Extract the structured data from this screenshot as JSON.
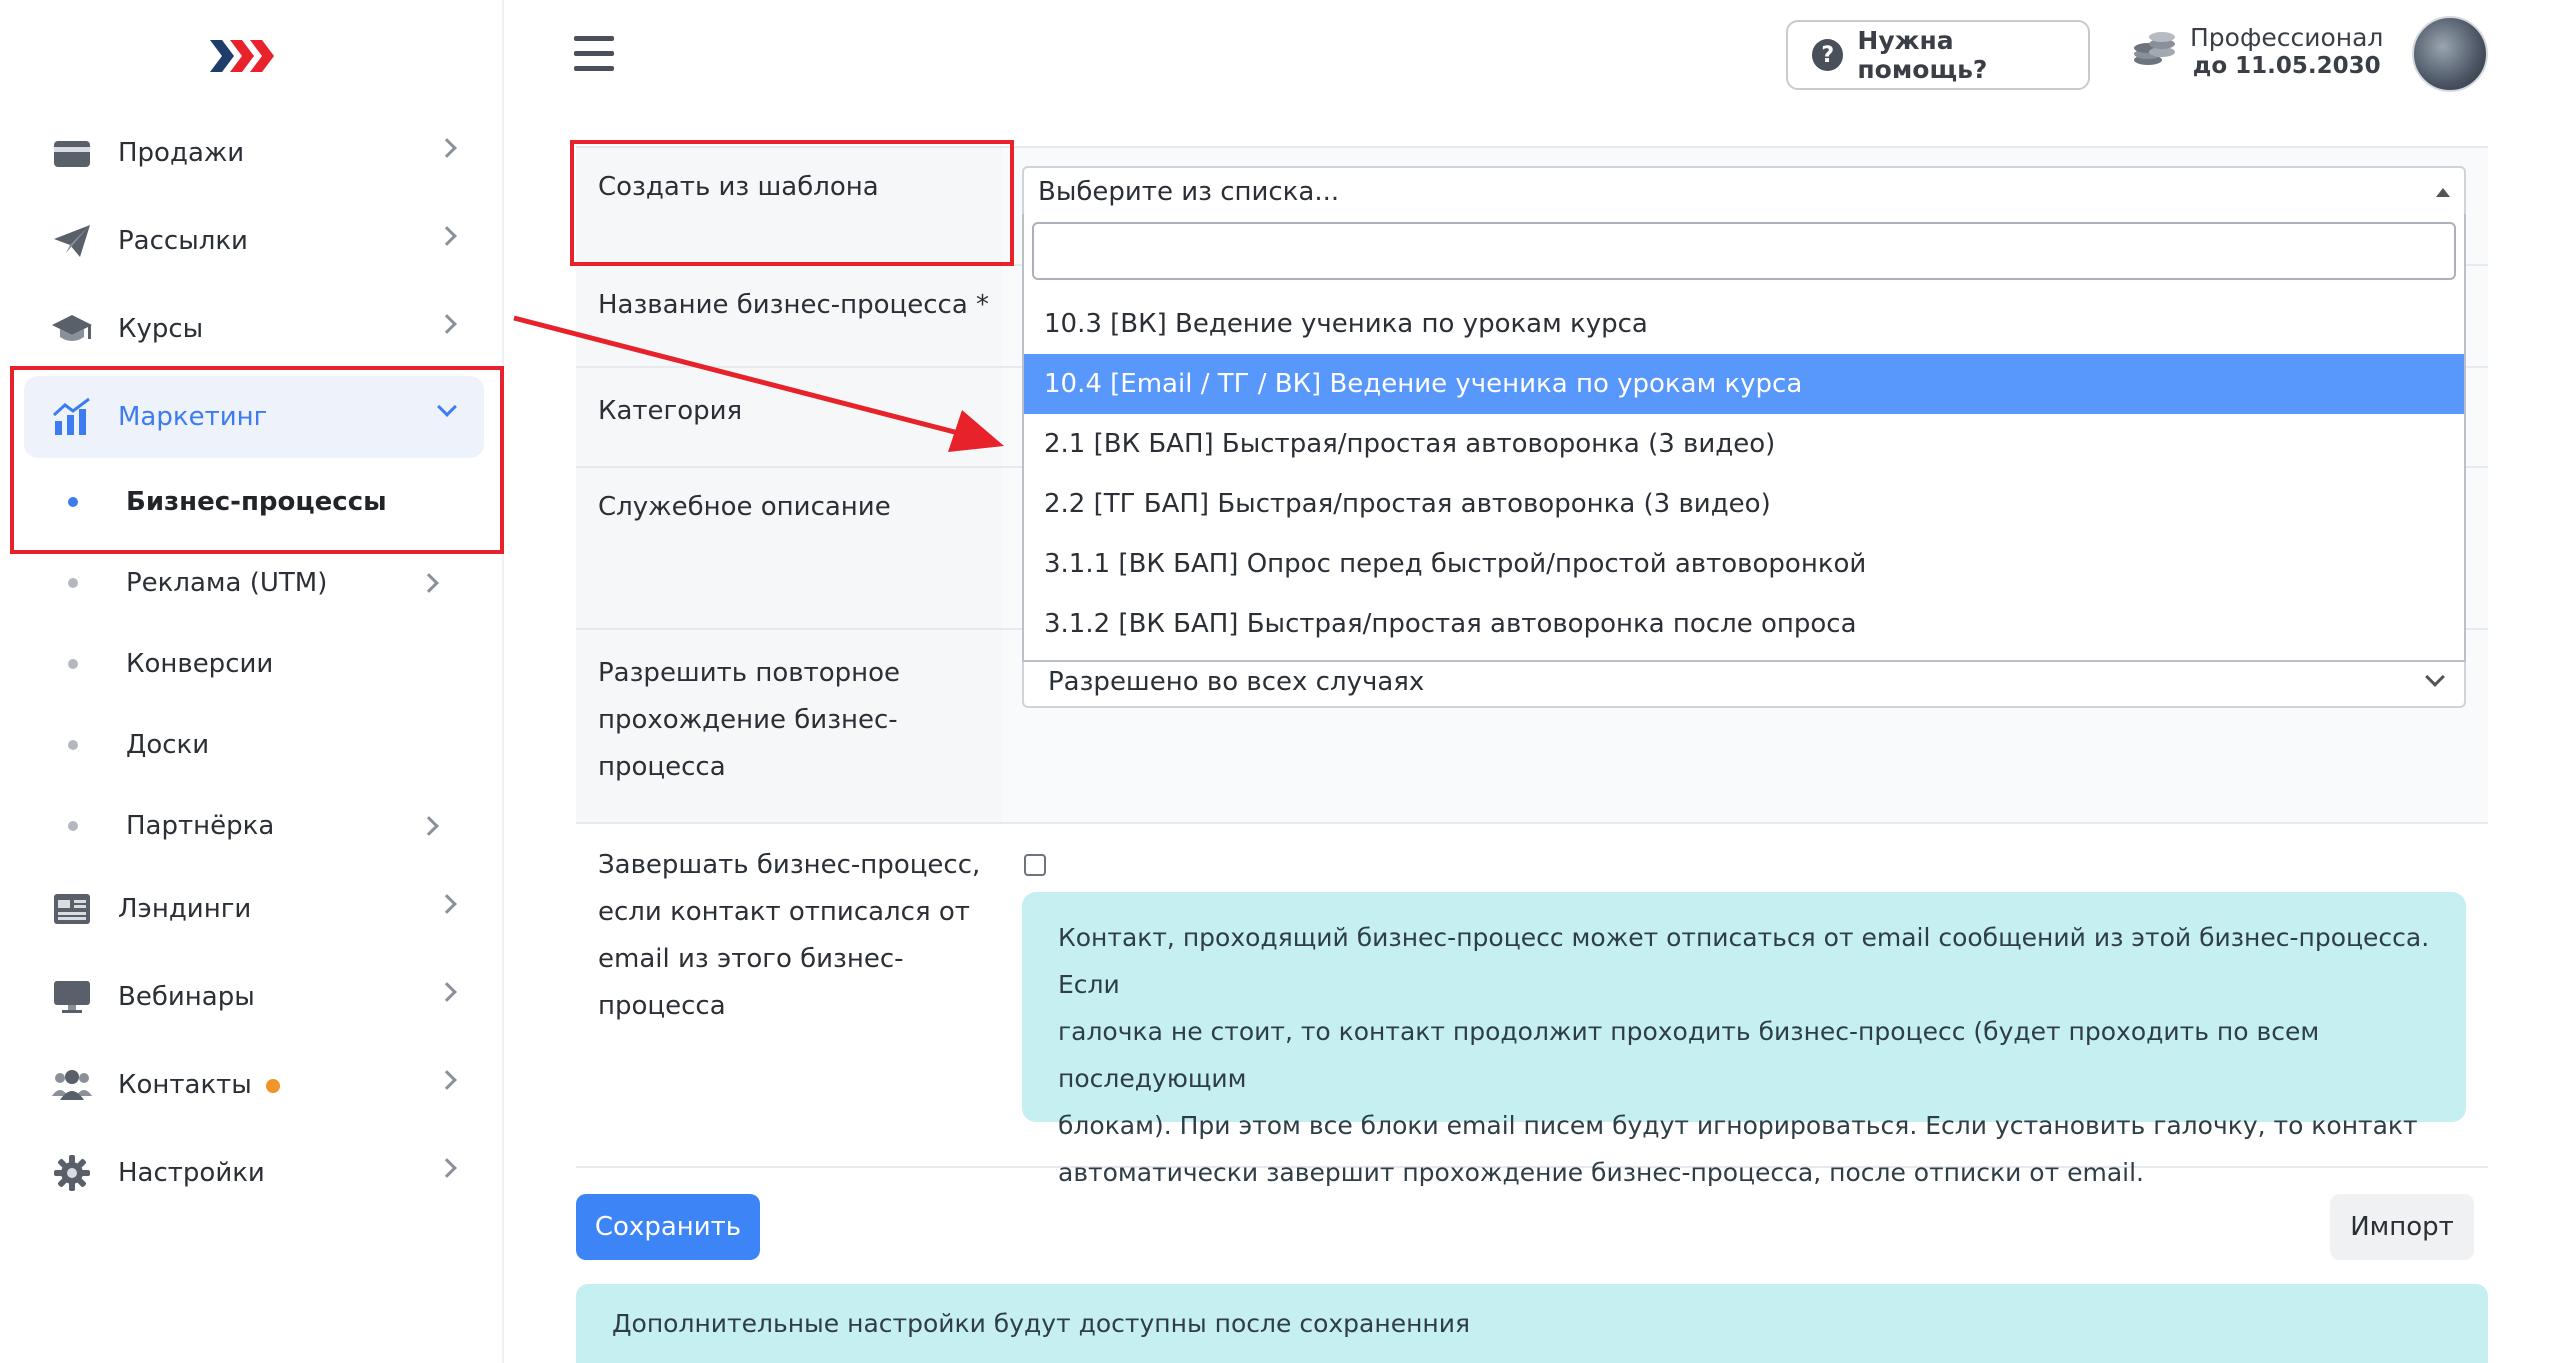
{
  "brand": {
    "logo_icon": "chevrons-logo-icon",
    "accent": "#3d7cf0",
    "highlight_color": "#e8222a"
  },
  "sidebar": {
    "items": [
      {
        "label": "Продажи",
        "icon": "credit-card-icon"
      },
      {
        "label": "Рассылки",
        "icon": "paper-plane-icon"
      },
      {
        "label": "Курсы",
        "icon": "graduation-cap-icon"
      },
      {
        "label": "Маркетинг",
        "icon": "chart-up-icon",
        "active": true
      },
      {
        "label": "Лэндинги",
        "icon": "landing-page-icon"
      },
      {
        "label": "Вебинары",
        "icon": "monitor-icon"
      },
      {
        "label": "Контакты",
        "icon": "users-icon"
      },
      {
        "label": "Настройки",
        "icon": "gear-icon"
      }
    ],
    "sub_items": [
      {
        "label": "Бизнес-процессы",
        "active": true
      },
      {
        "label": "Реклама (UTM)"
      },
      {
        "label": "Конверсии"
      },
      {
        "label": "Доски"
      },
      {
        "label": "Партнёрка"
      }
    ]
  },
  "header": {
    "help_label": "Нужна помощь?",
    "plan_name": "Профессионал",
    "plan_date": "до 11.05.2030"
  },
  "form": {
    "template_label": "Создать из шаблона",
    "template_placeholder": "Выберите из списка...",
    "name_label": "Название бизнес-процесса *",
    "category_label": "Категория",
    "description_label": "Служебное описание",
    "repeat_label_lines": [
      "Разрешить повторное",
      "прохождение бизнес-",
      "процесса"
    ],
    "repeat_value": "Разрешено во всех случаях",
    "finish_label_lines": [
      "Завершать бизнес-процесс,",
      "если контакт отписался от",
      "email из этого бизнес-",
      "процесса"
    ],
    "finish_checked": false,
    "finish_info_lines": [
      "Контакт, проходящий бизнес-процесс может отписаться от email сообщений из этой бизнес-процесса. Если",
      "галочка не стоит, то контакт продолжит проходить бизнес-процесс (будет проходить по всем последующим",
      "блокам). При этом все блоки email писем будут игнорироваться. Если установить галочку, то контакт",
      "автоматически завершит прохождение бизнес-процесса, после отписки от email."
    ]
  },
  "dropdown": {
    "search_value": "",
    "options": [
      "10.3 [ВК] Ведение ученика по урокам курса",
      "10.4 [Email / ТГ / ВК] Ведение ученика по урокам курса",
      "2.1 [ВК БАП] Быстрая/простая автоворонка (3 видео)",
      "2.2 [ТГ БАП] Быстрая/простая автоворонка (3 видео)",
      "3.1.1 [ВК БАП] Опрос перед быстрой/простой автоворонкой",
      "3.1.2 [ВК БАП] Быстрая/простая автоворонка после опроса"
    ],
    "highlighted_index": 1
  },
  "actions": {
    "save_label": "Сохранить",
    "import_label": "Импорт"
  },
  "bottom_note": "Дополнительные настройки будут доступны после сохраненния"
}
